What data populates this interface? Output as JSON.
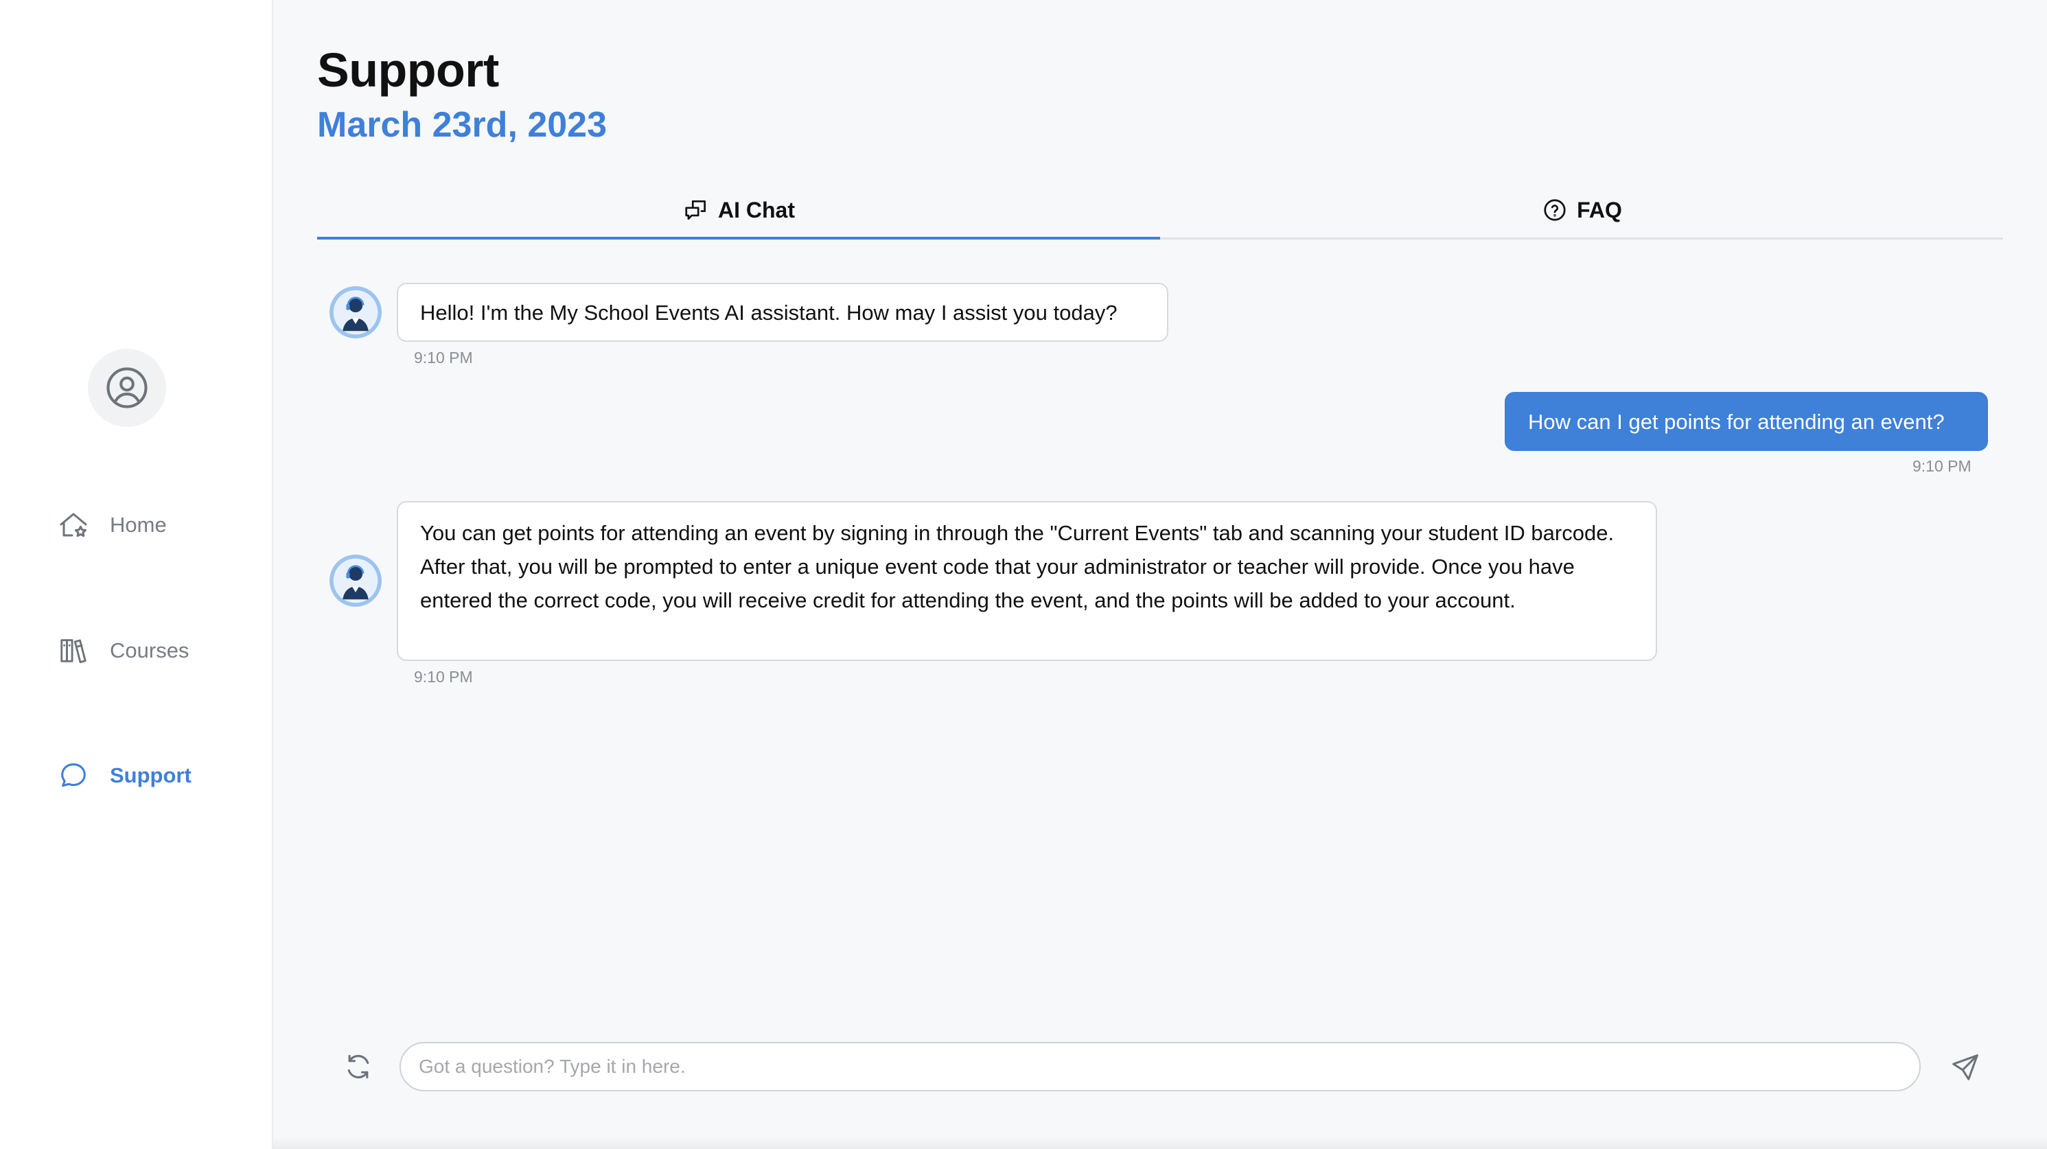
{
  "sidebar": {
    "avatar_icon": "user-circle-icon",
    "items": [
      {
        "label": "Home",
        "icon": "home-star-icon",
        "active": false
      },
      {
        "label": "Courses",
        "icon": "books-icon",
        "active": false
      },
      {
        "label": "Support",
        "icon": "chat-bubble-icon",
        "active": true
      }
    ]
  },
  "header": {
    "title": "Support",
    "date": "March 23rd, 2023"
  },
  "tabs": [
    {
      "label": "AI Chat",
      "icon": "chat-messages-icon",
      "active": true
    },
    {
      "label": "FAQ",
      "icon": "question-circle-icon",
      "active": false
    }
  ],
  "messages": [
    {
      "sender": "bot",
      "text": "Hello! I'm the My School Events AI assistant. How may I assist you today?",
      "time": "9:10 PM"
    },
    {
      "sender": "user",
      "text": "How can I get points for attending an event?",
      "time": "9:10 PM"
    },
    {
      "sender": "bot",
      "text": "You can get points for attending an event by signing in through the \"Current Events\" tab and scanning your student ID barcode. After that, you will be prompted to enter a unique event code that your administrator or teacher will provide. Once you have entered the correct code, you will receive credit for attending the event, and the points will be added to your account.",
      "time": "9:10 PM"
    }
  ],
  "composer": {
    "placeholder": "Got a question? Type it in here.",
    "value": "",
    "refresh_icon": "refresh-icon",
    "send_icon": "send-icon"
  },
  "colors": {
    "accent": "#3f80d8",
    "sidebar_bg": "#ffffff",
    "main_bg": "#f7f8fa"
  }
}
